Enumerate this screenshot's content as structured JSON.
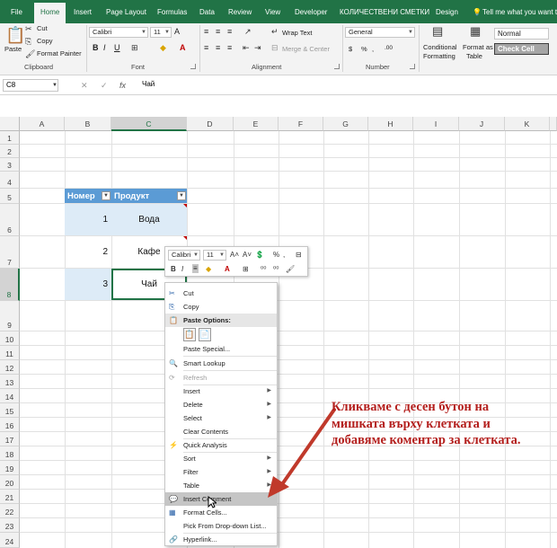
{
  "tabs": [
    "File",
    "Home",
    "Insert",
    "Page Layout",
    "Formulas",
    "Data",
    "Review",
    "View",
    "Developer",
    "КОЛИЧЕСТВЕНИ СМЕТКИ",
    "Design"
  ],
  "tell_me": "Tell me what you want to",
  "clipboard": {
    "paste": "Paste",
    "cut": "Cut",
    "copy": "Copy",
    "format_painter": "Format Painter",
    "label": "Clipboard"
  },
  "font": {
    "name": "Calibri",
    "size": "11",
    "bold": "B",
    "italic": "I",
    "underline": "U",
    "grow": "A",
    "label": "Font"
  },
  "alignment": {
    "wrap_text": "Wrap Text",
    "merge_center": "Merge & Center",
    "label": "Alignment"
  },
  "number": {
    "format": "General",
    "currency": "$",
    "percent": "%",
    "comma": ",",
    "inc_dec": ".00",
    "label": "Number"
  },
  "styles": {
    "conditional": "Conditional",
    "conditional2": "Formatting",
    "format_as": "Format as",
    "table": "Table",
    "normal": "Normal",
    "check_cell": "Check Cell"
  },
  "formula_bar": {
    "name_box": "C8",
    "value": "Чай",
    "cancel": "✕",
    "enter": "✓",
    "fx": "fx"
  },
  "columns": [
    "A",
    "B",
    "C",
    "D",
    "E",
    "F",
    "G",
    "H",
    "I",
    "J",
    "K"
  ],
  "rows": [
    "1",
    "2",
    "3",
    "4",
    "5",
    "6",
    "7",
    "8",
    "9",
    "10",
    "11",
    "12",
    "13",
    "14",
    "15",
    "16",
    "17",
    "18",
    "19",
    "20",
    "21",
    "22",
    "23",
    "24"
  ],
  "table": {
    "headers": [
      "Номер",
      "Продукт"
    ],
    "rows": [
      {
        "num": "1",
        "product": "Вода"
      },
      {
        "num": "2",
        "product": "Кафе"
      },
      {
        "num": "3",
        "product": "Чай"
      }
    ]
  },
  "mini_toolbar": {
    "font": "Calibri",
    "size": "11",
    "bold": "B",
    "italic": "I"
  },
  "context_menu": {
    "cut": "Cut",
    "copy": "Copy",
    "paste_options": "Paste Options:",
    "paste_special": "Paste Special...",
    "smart_lookup": "Smart Lookup",
    "refresh": "Refresh",
    "insert": "Insert",
    "delete": "Delete",
    "select": "Select",
    "clear_contents": "Clear Contents",
    "quick_analysis": "Quick Analysis",
    "sort": "Sort",
    "filter": "Filter",
    "table": "Table",
    "insert_comment": "Insert Comment",
    "format_cells": "Format Cells...",
    "pick_dropdown": "Pick From Drop-down List...",
    "hyperlink": "Hyperlink..."
  },
  "annotation": "Кликваме с десен бутон на мишката върху клетката и добавяме коментар за клетката.",
  "colors": {
    "excel_green": "#217346",
    "table_header": "#5b9bd5",
    "table_band": "#ddebf7",
    "annotation": "#b4201e"
  }
}
